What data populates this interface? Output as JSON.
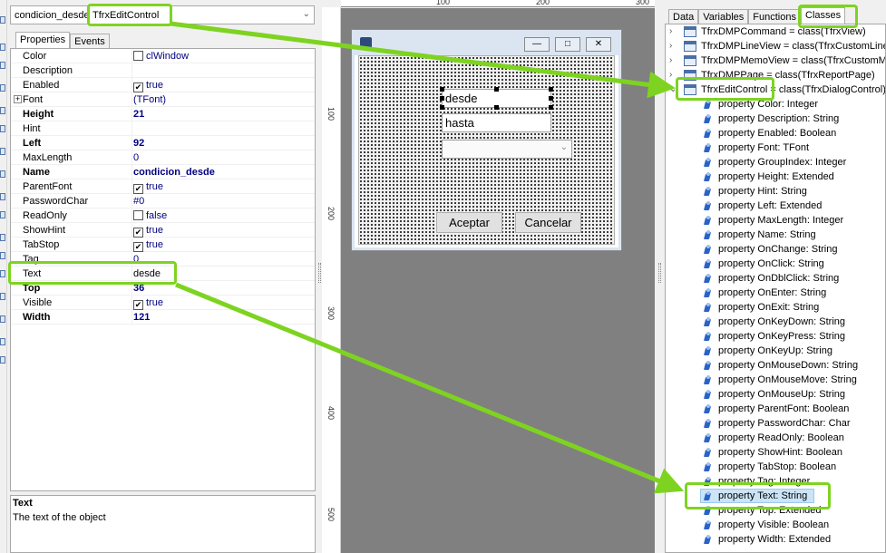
{
  "object_inspector": {
    "object_name": "condicion_desde",
    "object_class": "TfrxEditControl",
    "tabs": [
      "Properties",
      "Events"
    ],
    "properties": [
      {
        "name": "Color",
        "value": "clWindow",
        "check": "unchecked"
      },
      {
        "name": "Description",
        "value": ""
      },
      {
        "name": "Enabled",
        "value": "true",
        "check": "checked"
      },
      {
        "name": "Font",
        "value": "(TFont)",
        "expandable": "yes"
      },
      {
        "name": "Height",
        "value": "21",
        "bold": "yes"
      },
      {
        "name": "Hint",
        "value": ""
      },
      {
        "name": "Left",
        "value": "92",
        "bold": "yes"
      },
      {
        "name": "MaxLength",
        "value": "0"
      },
      {
        "name": "Name",
        "value": "condicion_desde",
        "bold": "yes"
      },
      {
        "name": "ParentFont",
        "value": "true",
        "check": "checked"
      },
      {
        "name": "PasswordChar",
        "value": "#0"
      },
      {
        "name": "ReadOnly",
        "value": "false",
        "check": "unchecked"
      },
      {
        "name": "ShowHint",
        "value": "true",
        "check": "checked"
      },
      {
        "name": "TabStop",
        "value": "true",
        "check": "checked"
      },
      {
        "name": "Tag",
        "value": "0"
      },
      {
        "name": "Text",
        "value": "desde",
        "selected": "yes"
      },
      {
        "name": "Top",
        "value": "36",
        "bold": "yes"
      },
      {
        "name": "Visible",
        "value": "true",
        "check": "checked"
      },
      {
        "name": "Width",
        "value": "121",
        "bold": "yes"
      }
    ],
    "description_title": "Text",
    "description_text": "The text of the object"
  },
  "designer": {
    "ruler_top": [
      "100",
      "200",
      "300"
    ],
    "ruler_left": [
      "100",
      "200",
      "300",
      "400",
      "500"
    ],
    "dialog": {
      "edit1": "desde",
      "edit2": "hasta",
      "ok_button": "Aceptar",
      "cancel_button": "Cancelar"
    }
  },
  "class_browser": {
    "tabs": [
      "Data",
      "Variables",
      "Functions",
      "Classes"
    ],
    "classes": [
      {
        "text": "TfrxDMPCommand = class(TfrxView)"
      },
      {
        "text": "TfrxDMPLineView = class(TfrxCustomLineView)"
      },
      {
        "text": "TfrxDMPMemoView = class(TfrxCustomMemoView)"
      },
      {
        "text": "TfrxDMPPage = class(TfrxReportPage)"
      },
      {
        "text": "TfrxEditControl = class(TfrxDialogControl)",
        "expanded": "yes"
      }
    ],
    "properties": [
      "property Color: Integer",
      "property Description: String",
      "property Enabled: Boolean",
      "property Font: TFont",
      "property GroupIndex: Integer",
      "property Height: Extended",
      "property Hint: String",
      "property Left: Extended",
      "property MaxLength: Integer",
      "property Name: String",
      "property OnChange: String",
      "property OnClick: String",
      "property OnDblClick: String",
      "property OnEnter: String",
      "property OnExit: String",
      "property OnKeyDown: String",
      "property OnKeyPress: String",
      "property OnKeyUp: String",
      "property OnMouseDown: String",
      "property OnMouseMove: String",
      "property OnMouseUp: String",
      "property ParentFont: Boolean",
      "property PasswordChar: Char",
      "property ReadOnly: Boolean",
      "property ShowHint: Boolean",
      "property TabStop: Boolean",
      "property Tag: Integer",
      "property Text: String",
      "property Top: Extended",
      "property Visible: Boolean",
      "property Width: Extended"
    ],
    "selected_property": "property Text: String"
  },
  "colors": {
    "highlight": "#7ed321",
    "selection": "#cce4f7",
    "value_text": "#000080"
  }
}
